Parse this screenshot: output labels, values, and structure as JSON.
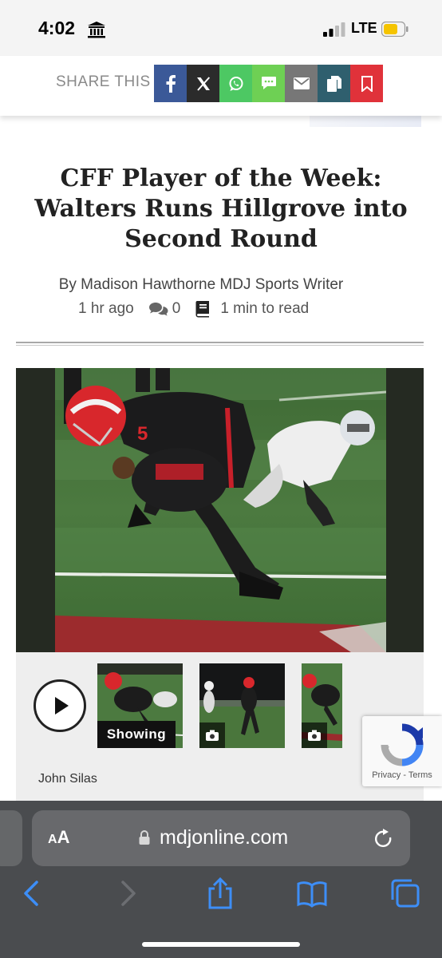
{
  "status_bar": {
    "time": "4:02",
    "network": "LTE",
    "bank_icon": "bank-icon",
    "battery_color": "#f5c400"
  },
  "share": {
    "label": "SHARE THIS",
    "buttons": [
      {
        "name": "facebook",
        "color": "#3b5998",
        "icon": "facebook-icon"
      },
      {
        "name": "x",
        "color": "#2b2b2b",
        "icon": "x-icon"
      },
      {
        "name": "whatsapp",
        "color": "#4dc863",
        "icon": "whatsapp-icon"
      },
      {
        "name": "sms",
        "color": "#6ed054",
        "icon": "sms-icon"
      },
      {
        "name": "email",
        "color": "#777777",
        "icon": "email-icon"
      },
      {
        "name": "copy",
        "color": "#2f5f6e",
        "icon": "copy-icon"
      },
      {
        "name": "save",
        "color": "#e0323a",
        "icon": "bookmark-icon"
      }
    ]
  },
  "article": {
    "title_line1": "CFF Player of the Week:",
    "title_line2": "Walters Runs Hillgrove into",
    "title_line3": "Second Round",
    "byline": "By Madison Hawthorne MDJ Sports Writer",
    "time_ago": "1 hr ago",
    "comments": "0",
    "read_time": "1 min to read"
  },
  "gallery": {
    "showing_label": "Showing",
    "photo_credit": "John Silas",
    "jersey_number": "5"
  },
  "recaptcha": {
    "privacy": "Privacy",
    "separator": " - ",
    "terms": "Terms"
  },
  "browser": {
    "aa_small": "A",
    "aa_large": "A",
    "url": "mdjonline.com"
  }
}
